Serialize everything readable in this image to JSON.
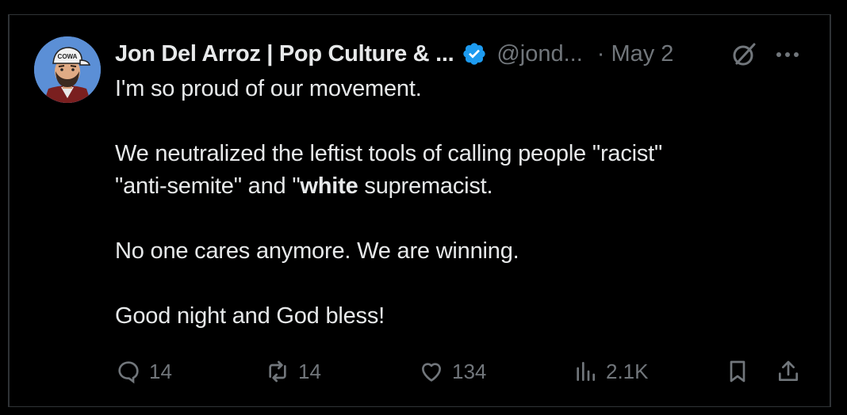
{
  "tweet": {
    "author": {
      "display_name": "Jon Del Arroz | Pop Culture & ...",
      "handle": "@jond...",
      "avatar_cap_text": "COWA"
    },
    "separator": "·",
    "date": "May 2",
    "text": {
      "line1": "I'm so proud of our movement.",
      "line2": "We neutralized the leftist tools of calling people \"racist\"",
      "line3_before": "\"anti-semite\" and \"",
      "line3_bold": "white",
      "line3_after": " supremacist.",
      "line4": "No one cares anymore. We are winning.",
      "line5": "Good night and God bless!"
    },
    "actions": {
      "replies": "14",
      "reposts": "14",
      "likes": "134",
      "views": "2.1K"
    }
  },
  "colors": {
    "background": "#000000",
    "text_primary": "#e7e9ea",
    "text_secondary": "#71767b",
    "verified_blue": "#1d9bf0",
    "border": "#2f3336"
  }
}
